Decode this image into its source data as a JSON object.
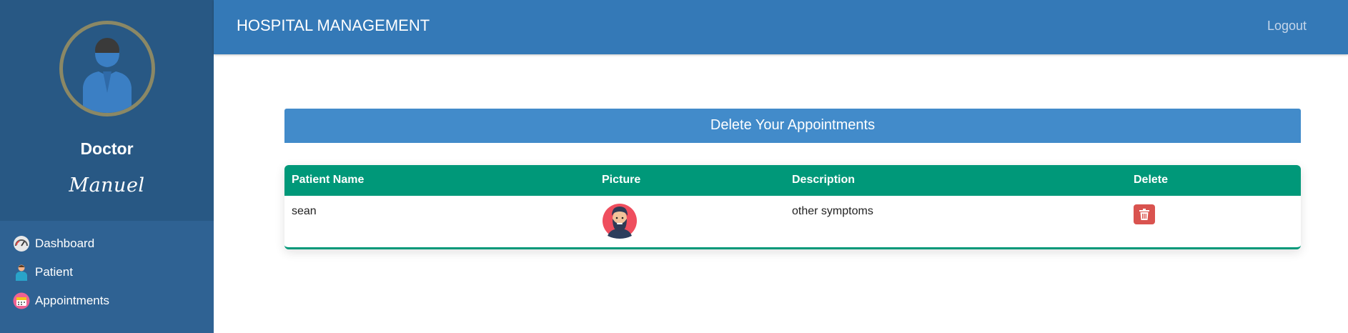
{
  "sidebar": {
    "profile": {
      "role": "Doctor",
      "name": "Manuel"
    },
    "items": [
      {
        "label": "Dashboard",
        "icon": "dashboard-gauge-icon"
      },
      {
        "label": "Patient",
        "icon": "patient-icon"
      },
      {
        "label": "Appointments",
        "icon": "calendar-icon"
      }
    ]
  },
  "header": {
    "title": "HOSPITAL MANAGEMENT",
    "logout_label": "Logout"
  },
  "main": {
    "panel_title": "Delete Your Appointments",
    "table": {
      "columns": [
        "Patient Name",
        "Picture",
        "Description",
        "Delete"
      ],
      "rows": [
        {
          "patient_name": "sean",
          "picture": "bearded-man-avatar",
          "description": "other symptoms",
          "delete_icon": "trash-icon"
        }
      ]
    }
  },
  "colors": {
    "sidebar": "#2f6293",
    "sidebar_profile": "#285884",
    "topbar": "#3479b7",
    "panel_heading": "#428bca",
    "table_header": "#009879",
    "delete_button": "#d9534f"
  }
}
